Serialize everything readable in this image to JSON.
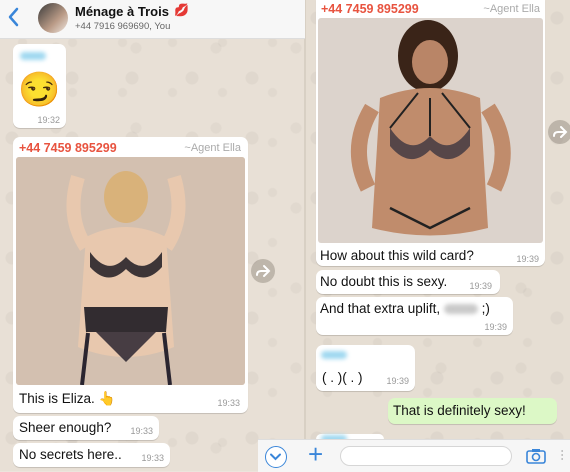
{
  "header": {
    "title": "Ménage à Trois",
    "lips": "💋",
    "subtitle": "+44 7916 969690, You"
  },
  "left_messages": {
    "emoji_msg": {
      "emoji": "😏",
      "time": "19:32"
    },
    "photo_msg": {
      "sender_number": "+44 7459 895299",
      "sender_alias": "~Agent Ella",
      "caption": "This is Eliza. 👆",
      "time": "19:33"
    },
    "msg2": {
      "text": "Sheer enough?",
      "time": "19:33"
    },
    "msg3": {
      "text": "No secrets here..",
      "time": "19:33"
    }
  },
  "right_messages": {
    "photo_msg": {
      "sender_number": "+44 7459 895299",
      "sender_alias": "~Agent Ella",
      "caption": "How about this wild card?",
      "time": "19:39"
    },
    "msg2": {
      "text": "No doubt this is sexy.",
      "time": "19:39"
    },
    "msg3": {
      "text_before": "And that extra uplift,",
      "text_after": ";)",
      "time": "19:39"
    },
    "msg4": {
      "text": "( . )( . )",
      "time": "19:39"
    },
    "outgoing": {
      "text": "That is definitely sexy!"
    }
  },
  "composer": {
    "plus": "+",
    "more": "···"
  },
  "colors": {
    "sender": "#e8533f",
    "accent": "#3a86d9",
    "outgoing_bubble": "#dcf8c6"
  },
  "icons": [
    "back-chevron-icon",
    "avatar",
    "forward-icon",
    "chevron-down-icon",
    "plus-icon",
    "camera-icon"
  ]
}
